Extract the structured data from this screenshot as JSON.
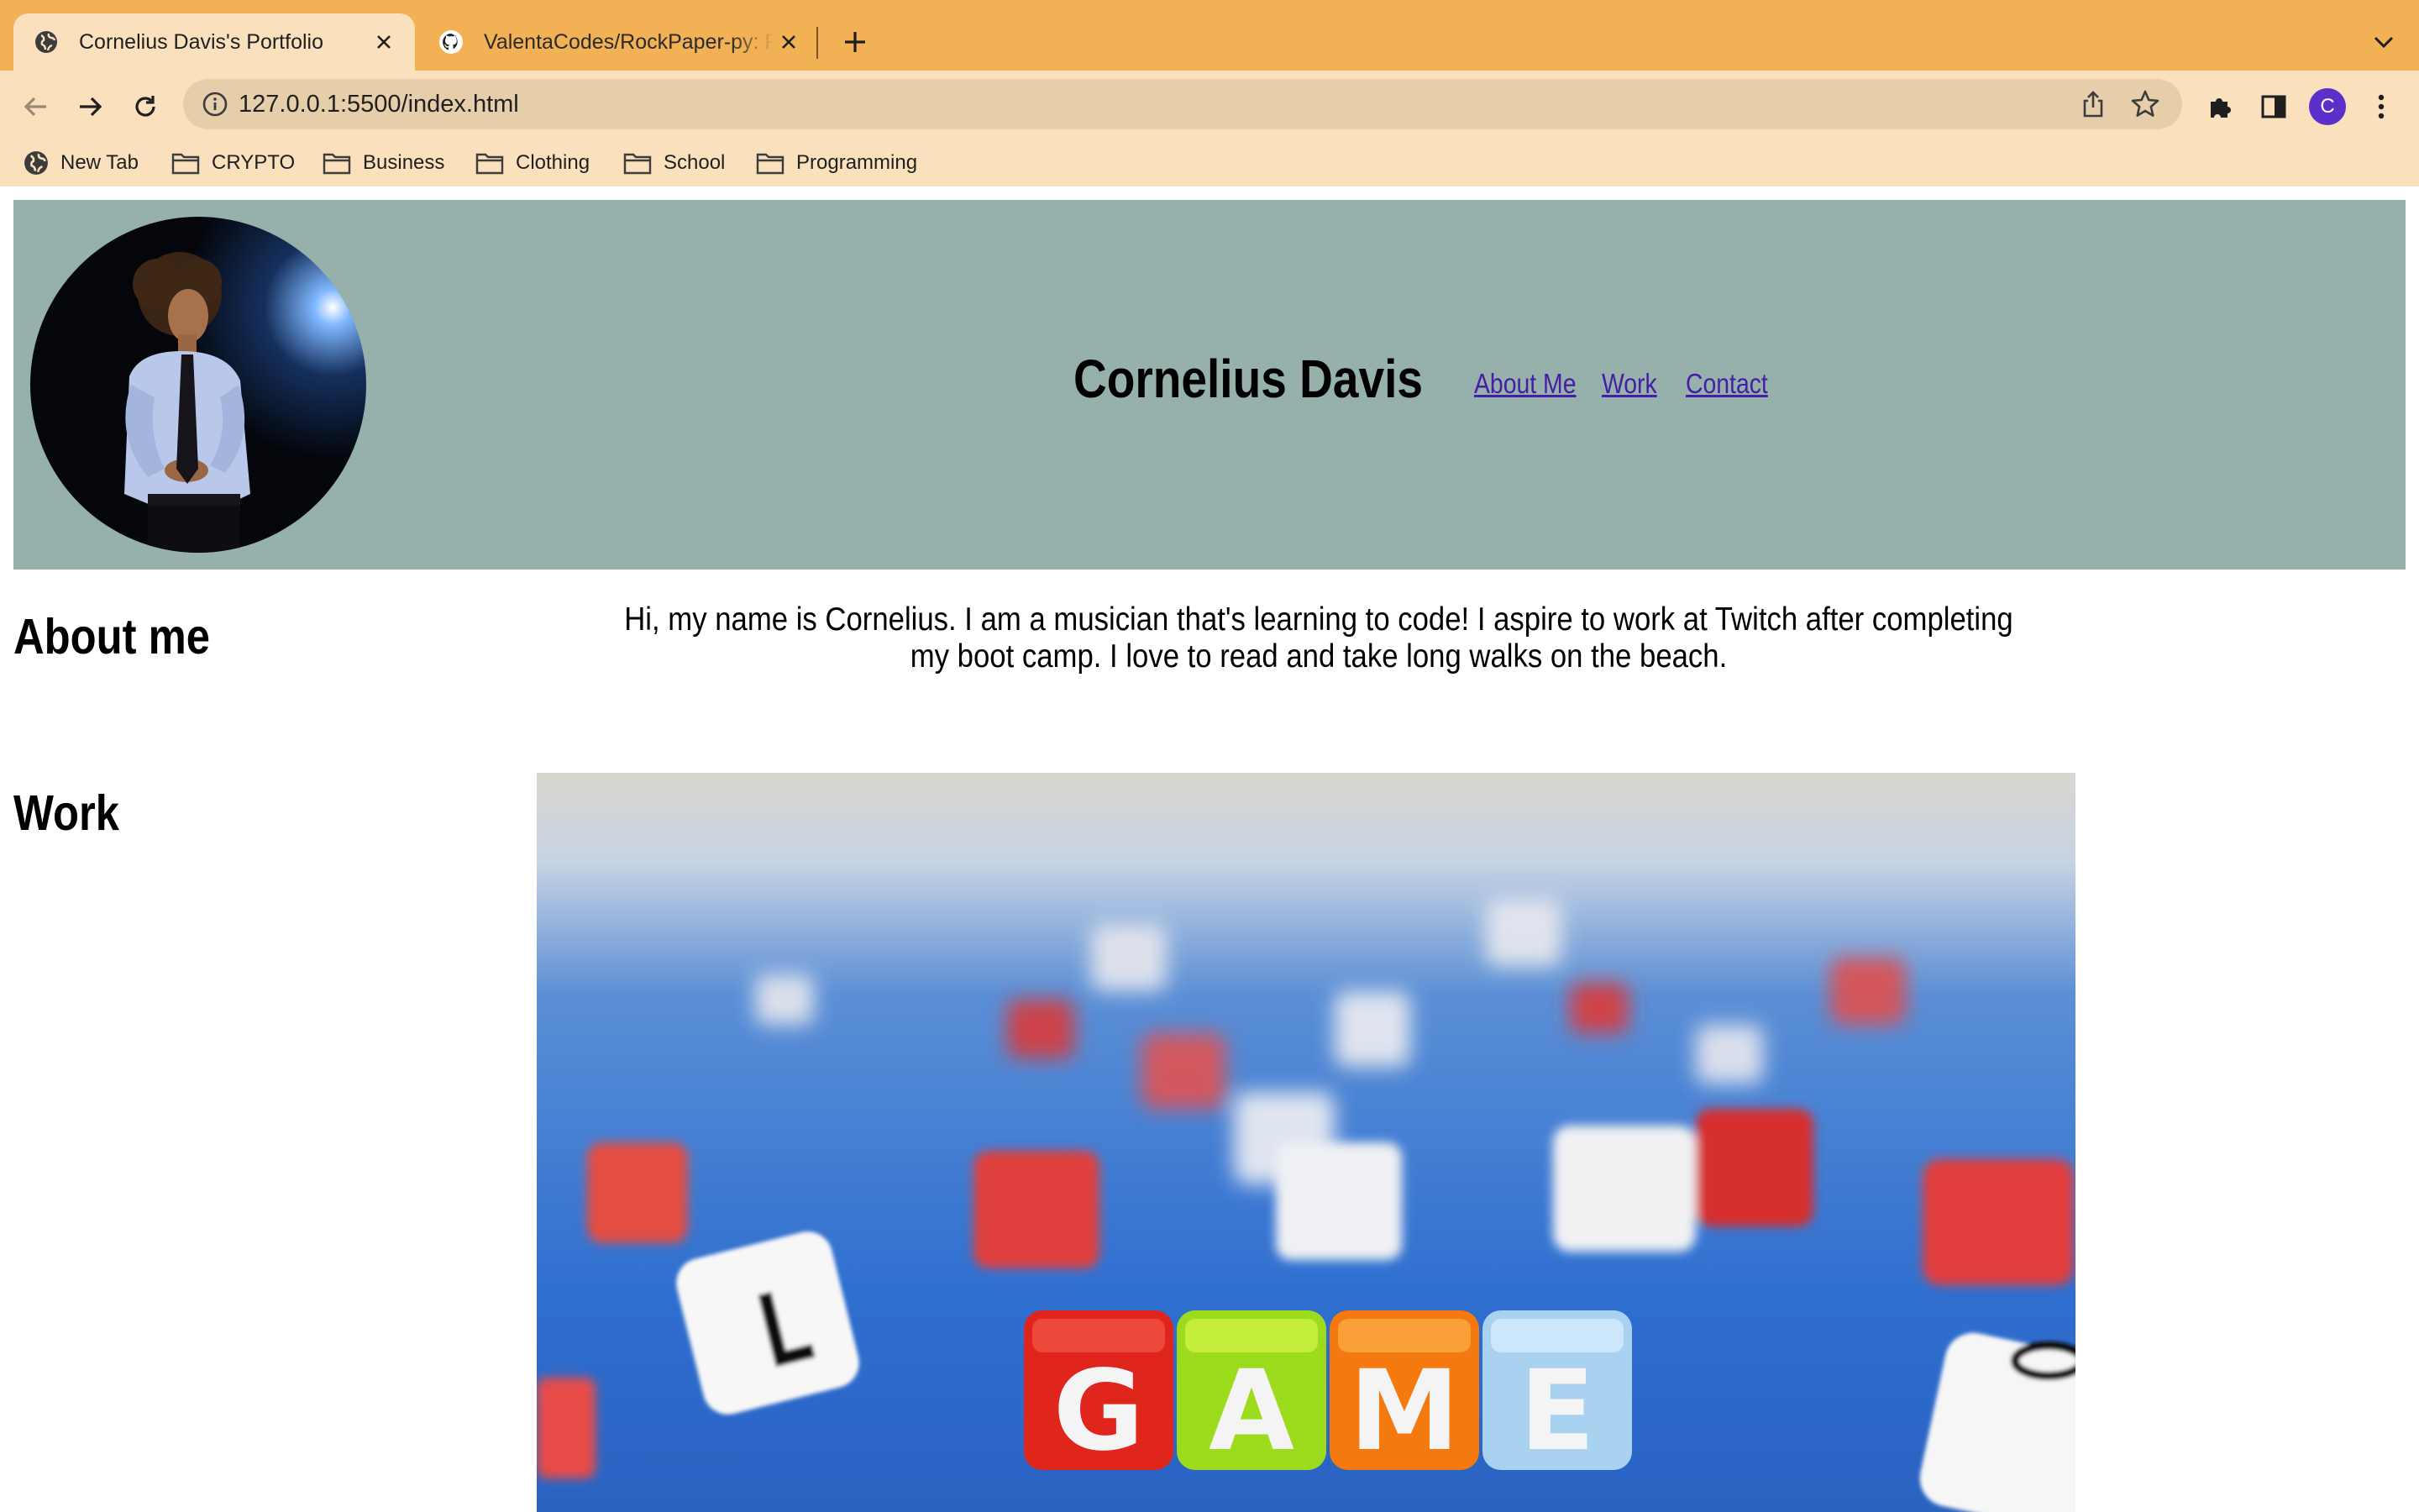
{
  "browser": {
    "tabs": [
      {
        "title": "Cornelius Davis's Portfolio",
        "icon": "globe-icon",
        "active": true
      },
      {
        "title": "ValentaCodes/RockPaper-py: R",
        "icon": "github-icon",
        "active": false
      }
    ],
    "address_bar": {
      "url": "127.0.0.1:5500/index.html"
    },
    "profile_initial": "C",
    "bookmarks": [
      {
        "label": "New Tab",
        "icon": "globe-icon"
      },
      {
        "label": "CRYPTO",
        "icon": "folder-icon"
      },
      {
        "label": "Business",
        "icon": "folder-icon"
      },
      {
        "label": "Clothing",
        "icon": "folder-icon"
      },
      {
        "label": "School",
        "icon": "folder-icon"
      },
      {
        "label": "Programming",
        "icon": "folder-icon"
      }
    ],
    "colors": {
      "tab_strip": "#f2b155",
      "toolbar": "#fae0bc",
      "profile": "#5b2fc9"
    }
  },
  "page": {
    "header": {
      "title": "Cornelius Davis",
      "nav": [
        "About Me",
        "Work",
        "Contact"
      ],
      "background": "#96b0ab",
      "link_color": "#451da6"
    },
    "about": {
      "heading": "About me",
      "text": "Hi, my name is Cornelius. I am a musician that's learning to code! I aspire to work at Twitch after completing my boot camp. I love to read and take long walks on the beach."
    },
    "work": {
      "heading": "Work",
      "image_letters": [
        "G",
        "A",
        "M",
        "E"
      ]
    }
  }
}
